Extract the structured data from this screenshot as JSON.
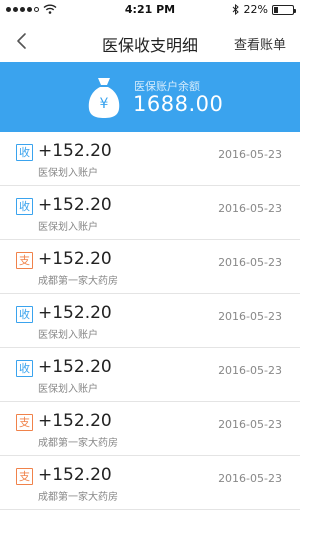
{
  "status_bar": {
    "time": "4:21 PM",
    "battery_percent": "22%",
    "battery_level": 0.22,
    "signal_bars": 4
  },
  "nav": {
    "title": "医保收支明细",
    "right_action": "查看账单",
    "back_icon": "chevron-left-icon"
  },
  "balance": {
    "label": "医保账户余额",
    "value": "1688.00",
    "icon": "money-bag-icon",
    "icon_glyph": "¥",
    "color": "#3aa3ee"
  },
  "colors": {
    "income": "#3aa3ee",
    "expense": "#f0824a"
  },
  "transactions": [
    {
      "type": "in",
      "tag": "收",
      "amount": "+152.20",
      "desc": "医保划入账户",
      "date": "2016-05-23"
    },
    {
      "type": "in",
      "tag": "收",
      "amount": "+152.20",
      "desc": "医保划入账户",
      "date": "2016-05-23"
    },
    {
      "type": "out",
      "tag": "支",
      "amount": "+152.20",
      "desc": "成都第一家大药房",
      "date": "2016-05-23"
    },
    {
      "type": "in",
      "tag": "收",
      "amount": "+152.20",
      "desc": "医保划入账户",
      "date": "2016-05-23"
    },
    {
      "type": "in",
      "tag": "收",
      "amount": "+152.20",
      "desc": "医保划入账户",
      "date": "2016-05-23"
    },
    {
      "type": "out",
      "tag": "支",
      "amount": "+152.20",
      "desc": "成都第一家大药房",
      "date": "2016-05-23"
    },
    {
      "type": "out",
      "tag": "支",
      "amount": "+152.20",
      "desc": "成都第一家大药房",
      "date": "2016-05-23"
    }
  ]
}
